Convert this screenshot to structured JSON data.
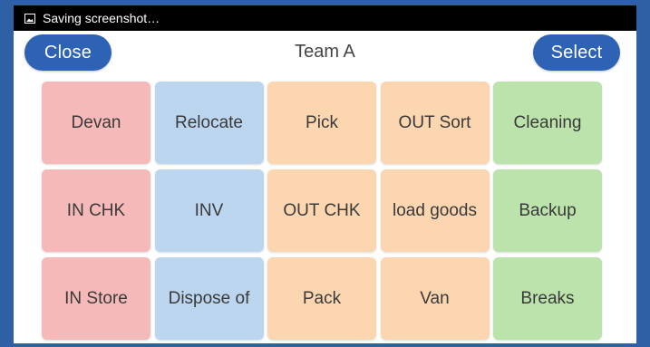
{
  "statusbar": {
    "icon": "image-icon",
    "text": "Saving screenshot…"
  },
  "header": {
    "close_label": "Close",
    "title": "Team A",
    "select_label": "Select"
  },
  "colors": {
    "accent": "#2e62b5",
    "red": "#f4b9b8",
    "blue": "#bcd6ef",
    "orange": "#fcd6b0",
    "green": "#bde3ad"
  },
  "tiles": [
    {
      "label": "Devan",
      "color": "red"
    },
    {
      "label": "Relocate",
      "color": "blue"
    },
    {
      "label": "Pick",
      "color": "orange"
    },
    {
      "label": "OUT Sort",
      "color": "orange"
    },
    {
      "label": "Cleaning",
      "color": "green"
    },
    {
      "label": "IN CHK",
      "color": "red"
    },
    {
      "label": "INV",
      "color": "blue"
    },
    {
      "label": "OUT CHK",
      "color": "orange"
    },
    {
      "label": "load goods",
      "color": "orange"
    },
    {
      "label": "Backup",
      "color": "green"
    },
    {
      "label": "IN Store",
      "color": "red"
    },
    {
      "label": "Dispose of",
      "color": "blue"
    },
    {
      "label": "Pack",
      "color": "orange"
    },
    {
      "label": "Van",
      "color": "orange"
    },
    {
      "label": "Breaks",
      "color": "green"
    }
  ]
}
